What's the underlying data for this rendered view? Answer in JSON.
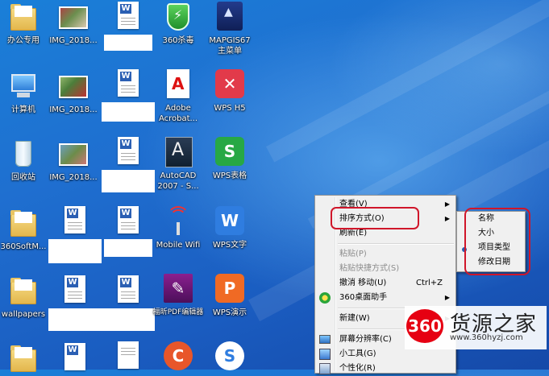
{
  "desktop": {
    "icons": [
      {
        "label": "办公专用",
        "icon": "folder-icon"
      },
      {
        "label": "IMG_2018...",
        "icon": "photo-icon"
      },
      {
        "label": "",
        "icon": "word-doc-icon"
      },
      {
        "label": "360杀毒",
        "icon": "360-antivirus-icon"
      },
      {
        "label": "MAPGIS67 主菜单",
        "icon": "mapgis-icon"
      },
      {
        "label": "计算机",
        "icon": "computer-icon"
      },
      {
        "label": "IMG_2018...",
        "icon": "photo-icon"
      },
      {
        "label": "",
        "icon": "word-doc-icon"
      },
      {
        "label": "Adobe Acrobat...",
        "icon": "adobe-acrobat-icon"
      },
      {
        "label": "WPS H5",
        "icon": "wps-h5-icon"
      },
      {
        "label": "回收站",
        "icon": "recycle-bin-icon"
      },
      {
        "label": "IMG_2018...",
        "icon": "photo-icon"
      },
      {
        "label": "",
        "icon": "word-doc-icon"
      },
      {
        "label": "AutoCAD 2007 - S...",
        "icon": "autocad-icon"
      },
      {
        "label": "WPS表格",
        "icon": "wps-spreadsheet-icon"
      },
      {
        "label": "360SoftM...",
        "icon": "folder-icon"
      },
      {
        "label": "",
        "icon": "word-doc-icon"
      },
      {
        "label": "",
        "icon": "word-doc-icon"
      },
      {
        "label": "Mobile Wifi",
        "icon": "mobile-wifi-icon"
      },
      {
        "label": "WPS文字",
        "icon": "wps-writer-icon"
      },
      {
        "label": "wallpapers",
        "icon": "folder-icon"
      },
      {
        "label": "",
        "icon": "word-doc-icon"
      },
      {
        "label": "",
        "icon": "word-doc-icon"
      },
      {
        "label": "福昕PDF编辑器",
        "icon": "foxit-pdf-icon"
      },
      {
        "label": "WPS演示",
        "icon": "wps-presentation-icon"
      }
    ]
  },
  "context_menu": {
    "items": [
      {
        "label": "查看(V)",
        "submenu": true
      },
      {
        "label": "排序方式(O)",
        "submenu": true
      },
      {
        "label": "刷新(E)"
      },
      {
        "label": "粘贴(P)",
        "disabled": true
      },
      {
        "label": "粘贴快捷方式(S)",
        "disabled": true
      },
      {
        "label": "撤消 移动(U)",
        "shortcut": "Ctrl+Z"
      },
      {
        "label": "360桌面助手",
        "submenu": true
      },
      {
        "label": "新建(W)",
        "submenu": true
      },
      {
        "label": "屏幕分辨率(C)"
      },
      {
        "label": "小工具(G)"
      },
      {
        "label": "个性化(R)"
      }
    ],
    "arrow_glyph": "▶"
  },
  "sort_submenu": {
    "items": [
      "名称",
      "大小",
      "项目类型",
      "修改日期"
    ]
  },
  "watermark": {
    "logo_text": "360",
    "name": "货源之家",
    "url": "www.360hyzj.com"
  },
  "colors": {
    "desktop_bg": "#1f6fd0",
    "highlight_border": "#d0162a",
    "menu_bg": "#f0f0f0"
  }
}
